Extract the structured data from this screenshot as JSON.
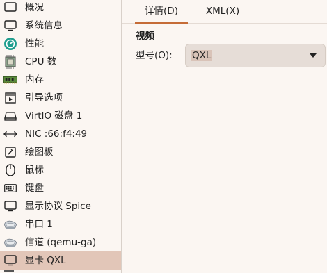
{
  "sidebar": {
    "items": [
      {
        "label": "概况",
        "icon": "overview-icon"
      },
      {
        "label": "系统信息",
        "icon": "monitor-icon"
      },
      {
        "label": "性能",
        "icon": "performance-icon"
      },
      {
        "label": "CPU 数",
        "icon": "cpu-icon"
      },
      {
        "label": "内存",
        "icon": "memory-icon"
      },
      {
        "label": "引导选项",
        "icon": "boot-icon"
      },
      {
        "label": "VirtIO 磁盘 1",
        "icon": "disk-icon"
      },
      {
        "label": "NIC :66:f4:49",
        "icon": "network-icon"
      },
      {
        "label": "绘图板",
        "icon": "tablet-icon"
      },
      {
        "label": "鼠标",
        "icon": "mouse-icon"
      },
      {
        "label": "键盘",
        "icon": "keyboard-icon"
      },
      {
        "label": "显示协议 Spice",
        "icon": "display-icon"
      },
      {
        "label": "串口 1",
        "icon": "serial-icon"
      },
      {
        "label": "信道 (qemu-ga)",
        "icon": "channel-icon"
      },
      {
        "label": "显卡 QXL",
        "icon": "video-icon"
      }
    ],
    "selected_index": 14
  },
  "tabs": [
    {
      "label": "详情(D)",
      "active": true
    },
    {
      "label": "XML(X)",
      "active": false
    }
  ],
  "video": {
    "section_title": "视频",
    "model_label": "型号(O):",
    "model_value": "QXL"
  },
  "colors": {
    "background": "#fbf6f2",
    "selection": "#e2c6b8",
    "accent": "#c56c37",
    "combo_bg": "#e6ddd7"
  }
}
